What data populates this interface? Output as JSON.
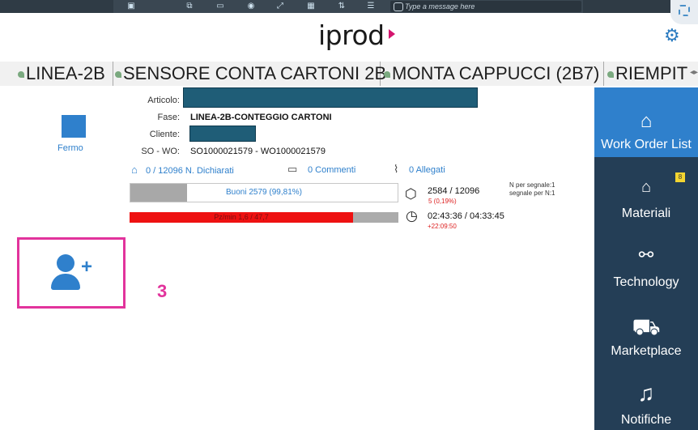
{
  "toolbar": {
    "message_placeholder": "Type a message here"
  },
  "header": {
    "logo": "iprod"
  },
  "tabs": [
    {
      "label": "LINEA-2B"
    },
    {
      "label": "SENSORE CONTA CARTONI 2B"
    },
    {
      "label": "MONTA CAPPUCCI (2B7)"
    },
    {
      "label": "RIEMPIT"
    }
  ],
  "status": {
    "label": "Fermo",
    "color": "#2f80cc"
  },
  "details": {
    "articolo_label": "Articolo:",
    "fase_label": "Fase:",
    "fase_value": "LINEA-2B-CONTEGGIO CARTONI",
    "cliente_label": "Cliente:",
    "so_wo_label": "SO - WO:",
    "so_wo_value": "SO1000021579 - WO1000021579"
  },
  "links": {
    "dichiarati": "0 / 12096 N. Dichiarati",
    "commenti": "0 Commenti",
    "allegati": "0 Allegati"
  },
  "progress": {
    "buoni_label": "Buoni 2579 (99,81%)",
    "buoni_fraction": 0.2132,
    "pz_label": "Pz/min 1,6 / 47,7",
    "pz_fraction": 0.83
  },
  "stats": {
    "pieces": "2584 / 12096",
    "scrap": "5 (0,19%)",
    "signal_line1": "N per segnale:1",
    "signal_line2": "segnale per N:1",
    "time": "02:43:36 / 04:33:45",
    "time_delta": "+22:09:50"
  },
  "annotation": "3",
  "sidebar": {
    "items": [
      {
        "label": "Work Order List",
        "icon": "home-icon"
      },
      {
        "label": "Materiali",
        "icon": "materials-icon",
        "badge": "8"
      },
      {
        "label": "Technology",
        "icon": "technology-icon"
      },
      {
        "label": "Marketplace",
        "icon": "cart-icon"
      },
      {
        "label": "Notifiche",
        "icon": "bell-icon"
      }
    ]
  },
  "colors": {
    "accent": "#2f80cc",
    "sidebar": "#243e56",
    "highlight": "#e2339c",
    "progress_red": "#ee1111"
  }
}
